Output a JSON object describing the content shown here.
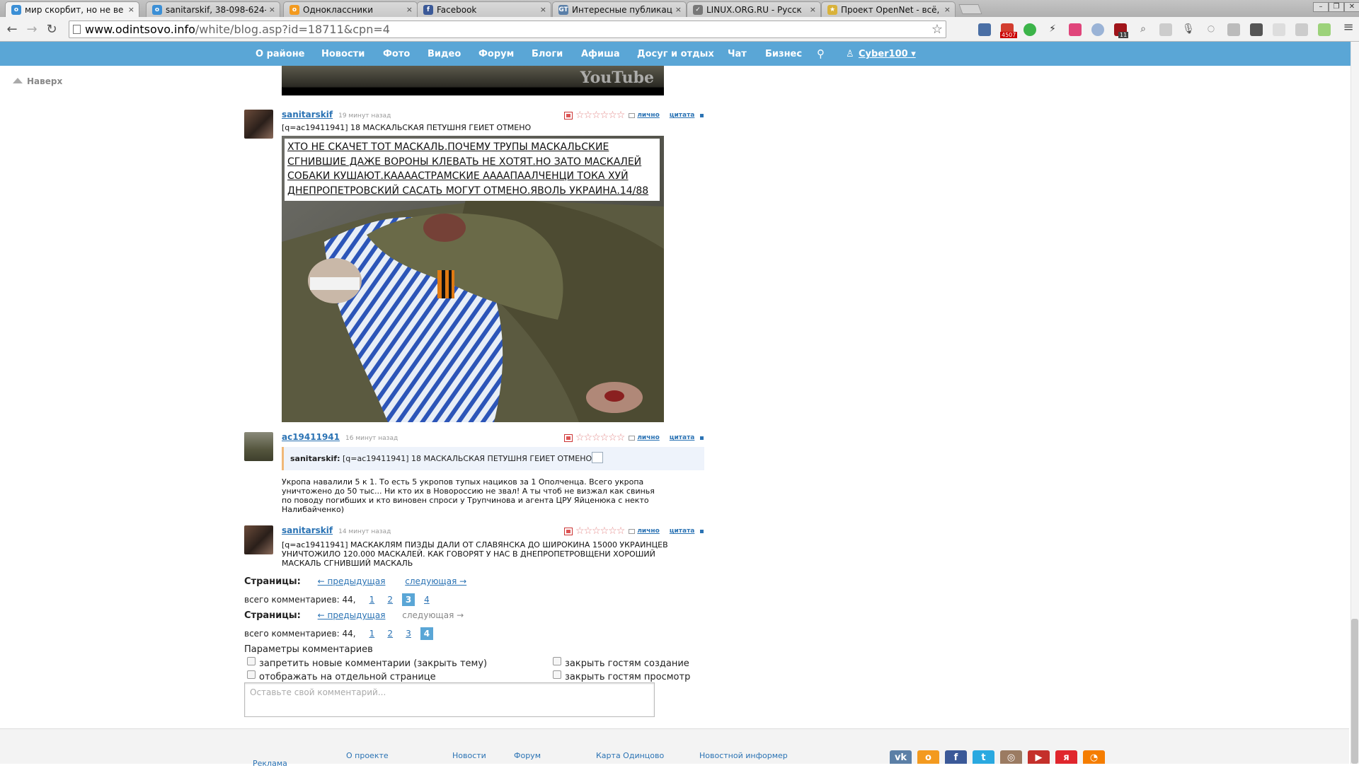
{
  "browser": {
    "tabs": [
      {
        "title": "мир скорбит, но не ве",
        "color": "#3b8fd6",
        "glyph": "o",
        "active": true
      },
      {
        "title": "sanitarskif, 38-098-624-",
        "color": "#3b8fd6",
        "glyph": "o",
        "active": false
      },
      {
        "title": "Одноклассники",
        "color": "#f39a1f",
        "glyph": "о",
        "active": false
      },
      {
        "title": "Facebook",
        "color": "#3b5998",
        "glyph": "f",
        "active": false
      },
      {
        "title": "Интересные публикац",
        "color": "#5a7fa8",
        "glyph": "GT",
        "active": false
      },
      {
        "title": "LINUX.ORG.RU - Русск",
        "color": "#777777",
        "glyph": "✓",
        "active": false
      },
      {
        "title": "Проект OpenNet - всё,",
        "color": "#d9b23a",
        "glyph": "★",
        "active": false
      }
    ],
    "tab_close": "×",
    "url_host": "www.odintsovo.info",
    "url_path": "/white/blog.asp?id=18711&cpn=4",
    "gmail_badge": "4507",
    "ublock_badge": "11"
  },
  "site_nav": {
    "items": [
      "О районе",
      "Новости",
      "Фото",
      "Видео",
      "Форум",
      "Блоги",
      "Афиша",
      "Досуг и отдых",
      "Чат",
      "Бизнес"
    ],
    "user": "Cyber100"
  },
  "to_top": "Наверх",
  "video": {
    "logo": "YouTube"
  },
  "comments": [
    {
      "author": "sanitarskif",
      "time": "19 минут назад",
      "text": "[q=ac19411941] 18 МАСКАЛЬСКАЯ ПЕТУШНЯ ГЕИЕТ ОТМЕНО",
      "image_caption_lines": [
        "ХТО НЕ СКАЧЕТ ТОТ МАСКАЛЬ.ПОЧЕМУ ТРУПЫ МАСКАЛЬСКИЕ",
        "СГНИВШИЕ ДАЖЕ ВОРОНЫ КЛЕВАТЬ НЕ ХОТЯТ.НО ЗАТО МАСКАЛЕЙ",
        "СОБАКИ КУШАЮТ.КААААСТРАМСКИЕ АААAПААЛЧЕНЦИ ТОКА ХУЙ",
        "ДНЕПРОПЕТРОВСКИЙ САСАТЬ МОГУТ ОТМЕНО.ЯВОЛЬ УКРАИНА.14/88"
      ]
    },
    {
      "author": "ac19411941",
      "time": "16 минут назад",
      "quote_author": "sanitarskif:",
      "quote_text": "[q=ac19411941] 18 МАСКАЛЬСКАЯ ПЕТУШНЯ ГЕИЕТ ОТМЕНО",
      "text_lines": [
        "Укропа навалили 5 к 1. То есть 5 укропов тупых нациков за 1 Ополченца. Всего укропа",
        "уничтожено до 50 тыс... Ни кто их в Новороссию не звал! А ты чтоб не визжал как свинья",
        "по поводу погибших и кто виновен спроси у Трупчинова и агента ЦРУ Яйценюка с некто",
        "Налибайченко)"
      ]
    },
    {
      "author": "sanitarskif",
      "time": "14 минут назад",
      "text_lines": [
        "[q=ac19411941] МАСКАКЛЯМ ПИЗДЫ ДАЛИ ОТ СЛАВЯНСКА ДО ШИРОКИНА 15000 УКРАИНЦЕВ",
        "УНИЧТОЖИЛО 120.000 МАСКАЛЕЙ. КАК ГОВОРЯТ У НАС В ДНЕПРОПЕТРОВЩЕНИ ХОРОШИЙ",
        "МАСКАЛЬ СГНИВШИЙ МАСКАЛЬ"
      ]
    }
  ],
  "comment_tools": {
    "stars": "☆☆☆☆☆☆",
    "private": "лично",
    "quote": "цитата"
  },
  "pagers": [
    {
      "label": "Страницы:",
      "prev": "← предыдущая",
      "next": "следующая →",
      "next_enabled": true,
      "total": "всего  комментариев: 44,",
      "pages": [
        "1",
        "2",
        "3",
        "4"
      ],
      "current": "3"
    },
    {
      "label": "Страницы:",
      "prev": "← предыдущая",
      "next": "следующая →",
      "next_enabled": false,
      "total": "всего  комментариев: 44,",
      "pages": [
        "1",
        "2",
        "3",
        "4"
      ],
      "current": "4"
    }
  ],
  "params": {
    "title": "Параметры комментариев",
    "options": [
      "запретить новые комментарии (закрыть тему)",
      "отображать на отдельной странице",
      "закрыть гостям создание",
      "закрыть гостям просмотр"
    ],
    "placeholder": "Оставьте свой комментарий..."
  },
  "footer": {
    "links": [
      "Реклама",
      "О проекте",
      "Новости",
      "Форум",
      "Карта Одинцово",
      "Новостной информер"
    ],
    "social": [
      {
        "glyph": "vk",
        "color": "#5b7fa6"
      },
      {
        "glyph": "о",
        "color": "#f39a1f"
      },
      {
        "glyph": "f",
        "color": "#3b5998"
      },
      {
        "glyph": "t",
        "color": "#2aa9e0"
      },
      {
        "glyph": "◎",
        "color": "#9b7b62"
      },
      {
        "glyph": "▶",
        "color": "#c4302b"
      },
      {
        "glyph": "я",
        "color": "#e0262d"
      },
      {
        "glyph": "◔",
        "color": "#f57d00"
      }
    ]
  }
}
